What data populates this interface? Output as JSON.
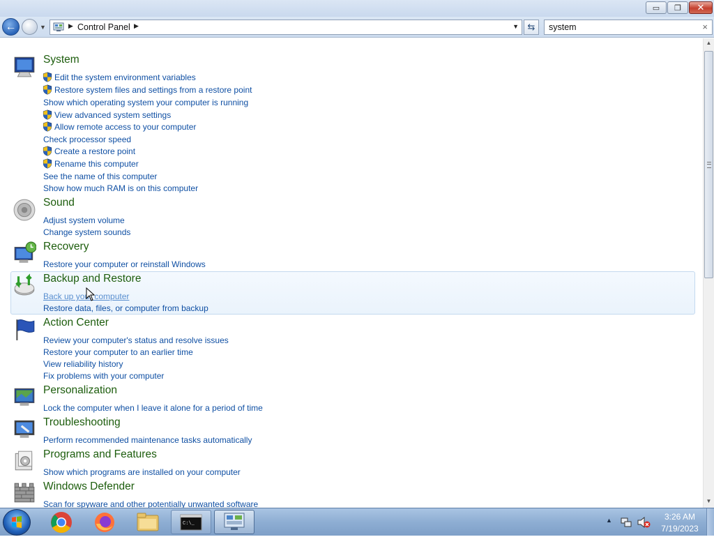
{
  "window": {
    "minimize_glyph": "▭",
    "maximize_glyph": "❐",
    "close_glyph": "✕"
  },
  "navbar": {
    "back_glyph": "←",
    "breadcrumb": "Control Panel",
    "search_value": "system",
    "search_clear": "×"
  },
  "groups": [
    {
      "title": "System",
      "icon": "system-computer-icon",
      "links": [
        {
          "label": "Edit the system environment variables",
          "shield": true
        },
        {
          "label": "Restore system files and settings from a restore point",
          "shield": true
        },
        {
          "label": "Show which operating system your computer is running",
          "shield": false
        },
        {
          "label": "View advanced system settings",
          "shield": true
        },
        {
          "label": "Allow remote access to your computer",
          "shield": true
        },
        {
          "label": "Check processor speed",
          "shield": false
        },
        {
          "label": "Create a restore point",
          "shield": true
        },
        {
          "label": "Rename this computer",
          "shield": true
        },
        {
          "label": "See the name of this computer",
          "shield": false
        },
        {
          "label": "Show how much RAM is on this computer",
          "shield": false
        }
      ]
    },
    {
      "title": "Sound",
      "icon": "speaker-icon",
      "links": [
        {
          "label": "Adjust system volume",
          "shield": false
        },
        {
          "label": "Change system sounds",
          "shield": false
        }
      ]
    },
    {
      "title": "Recovery",
      "icon": "recovery-icon",
      "links": [
        {
          "label": "Restore your computer or reinstall Windows",
          "shield": false
        }
      ]
    },
    {
      "title": "Backup and Restore",
      "icon": "backup-restore-icon",
      "links": [
        {
          "label": "Back up your computer",
          "shield": false
        },
        {
          "label": "Restore data, files, or computer from backup",
          "shield": false
        }
      ]
    },
    {
      "title": "Action Center",
      "icon": "action-center-flag-icon",
      "links": [
        {
          "label": "Review your computer's status and resolve issues",
          "shield": false
        },
        {
          "label": "Restore your computer to an earlier time",
          "shield": false
        },
        {
          "label": "View reliability history",
          "shield": false
        },
        {
          "label": "Fix problems with your computer",
          "shield": false
        }
      ]
    },
    {
      "title": "Personalization",
      "icon": "personalization-icon",
      "links": [
        {
          "label": "Lock the computer when I leave it alone for a period of time",
          "shield": false
        }
      ]
    },
    {
      "title": "Troubleshooting",
      "icon": "troubleshooting-icon",
      "links": [
        {
          "label": "Perform recommended maintenance tasks automatically",
          "shield": false
        }
      ]
    },
    {
      "title": "Programs and Features",
      "icon": "programs-features-icon",
      "links": [
        {
          "label": "Show which programs are installed on your computer",
          "shield": false
        }
      ]
    },
    {
      "title": "Windows Defender",
      "icon": "windows-defender-icon",
      "links": [
        {
          "label": "Scan for spyware and other potentially unwanted software",
          "shield": false
        }
      ]
    }
  ],
  "taskbar": {
    "apps": [
      "start-orb",
      "chrome",
      "firefox",
      "file-explorer",
      "command-prompt",
      "control-panel"
    ],
    "clock_time": "3:26 AM",
    "clock_date": "7/19/2023"
  },
  "colors": {
    "title_green": "#1d5d0d",
    "link_blue": "#0f4fa3",
    "hover_link": "#5a8fd0",
    "highlight_bg": "#eaf3fc"
  }
}
